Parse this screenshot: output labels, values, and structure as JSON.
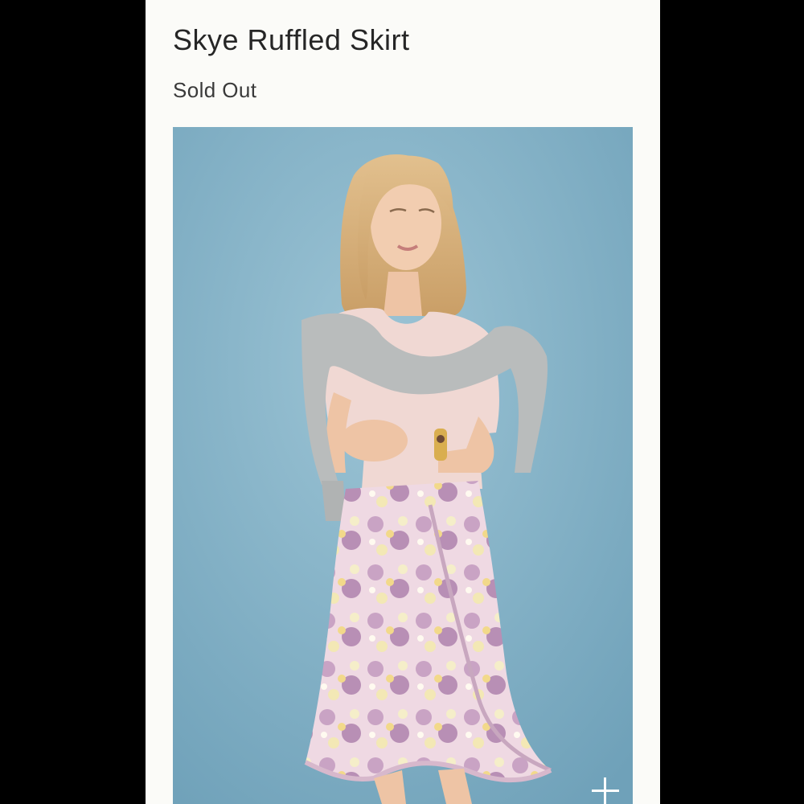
{
  "product": {
    "title": "Skye Ruffled Skirt",
    "availability": "Sold Out"
  },
  "gallery": {
    "image_subject": "model wearing floral ruffled wrap skirt",
    "zoom_icon": "plus-icon"
  },
  "colors": {
    "page_background": "#000000",
    "card_background": "#fbfbf8",
    "photo_backdrop": "#84b2c7",
    "title_text": "#262626"
  }
}
